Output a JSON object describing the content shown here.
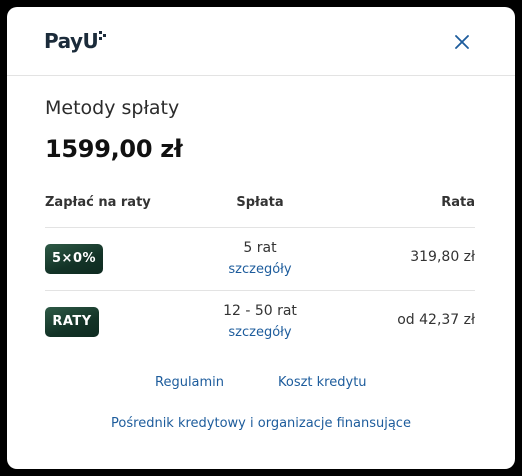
{
  "header": {
    "logo_text": "PayU",
    "close_icon": "close-icon"
  },
  "main": {
    "title": "Metody spłaty",
    "amount": "1599,00 zł"
  },
  "table": {
    "headers": [
      "Zapłać na raty",
      "Spłata",
      "Rata"
    ],
    "rows": [
      {
        "badge": "5×0%",
        "count": "5 rat",
        "details": "szczegóły",
        "rate": "319,80 zł"
      },
      {
        "badge": "RATY",
        "count": "12 - 50 rat",
        "details": "szczegóły",
        "rate": "od 42,37 zł"
      }
    ]
  },
  "footer": {
    "terms": "Regulamin",
    "credit_cost": "Koszt kredytu",
    "intermediary": "Pośrednik kredytowy i organizacje finansujące"
  },
  "colors": {
    "accent_link": "#1d5c9c",
    "badge_green": "#133327",
    "brand_lime": "#a6c307"
  }
}
